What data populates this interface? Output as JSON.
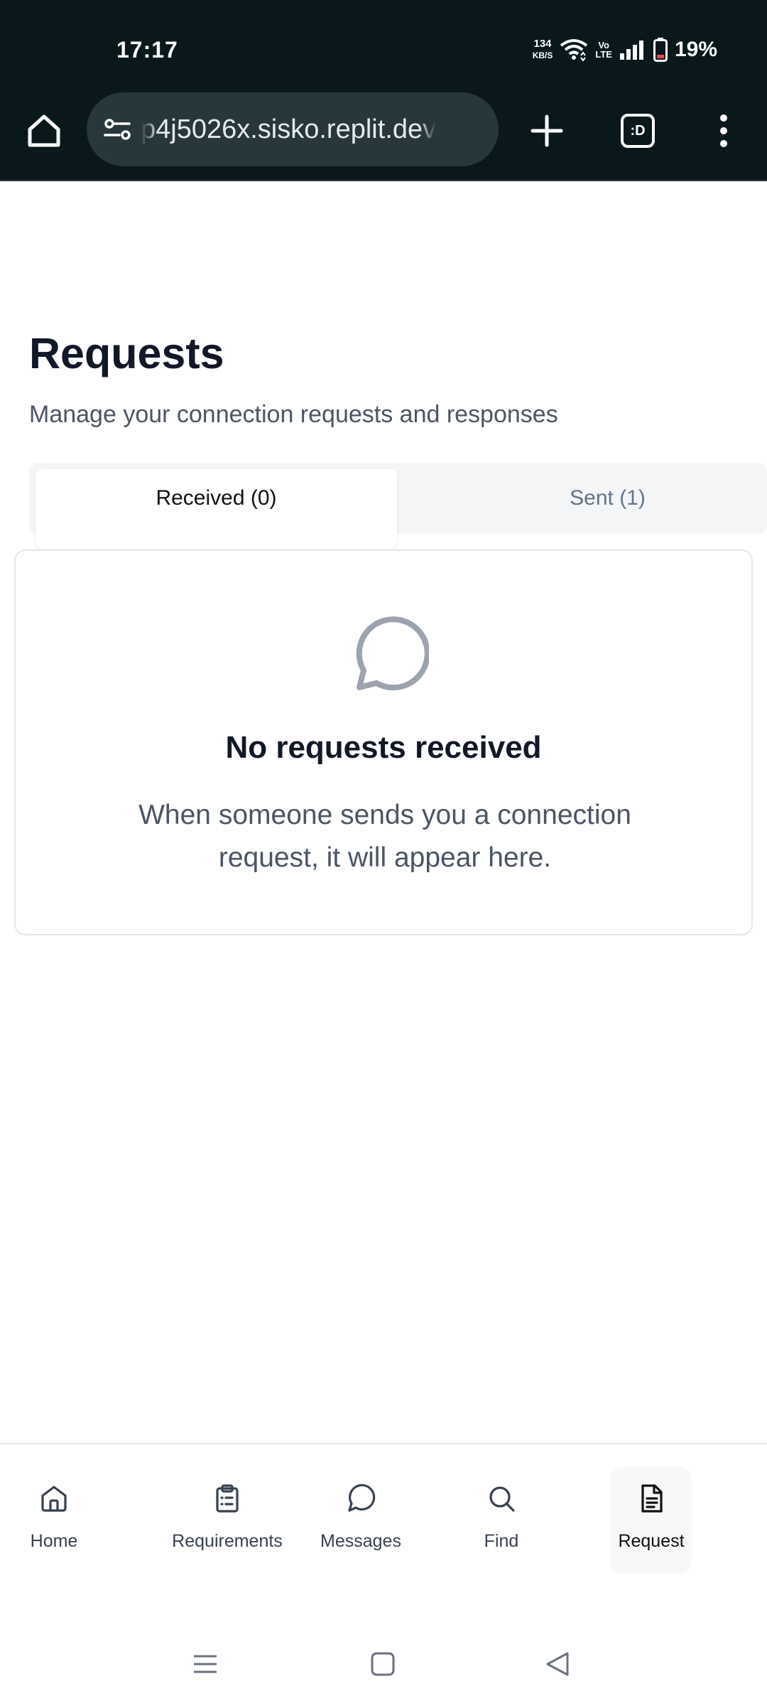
{
  "status_bar": {
    "time": "17:17",
    "net_speed_value": "134",
    "net_speed_unit": "KB/S",
    "volte_top": "Vo",
    "volte_bottom": "LTE",
    "battery_percent": "19%"
  },
  "browser": {
    "url": "p4j5026x.sisko.replit.dev",
    "tab_switcher_label": ":D"
  },
  "page": {
    "title": "Requests",
    "subtitle": "Manage your connection requests and responses"
  },
  "tabs": [
    {
      "label": "Received (0)",
      "active": true
    },
    {
      "label": "Sent (1)",
      "active": false
    }
  ],
  "empty_state": {
    "icon": "message-circle-icon",
    "title": "No requests received",
    "description": "When someone sends you a connection request, it will appear here."
  },
  "bottom_nav": [
    {
      "label": "Home",
      "icon": "home-icon",
      "active": false
    },
    {
      "label": "Requirements",
      "icon": "clipboard-list-icon",
      "active": false
    },
    {
      "label": "Messages",
      "icon": "message-circle-icon",
      "active": false
    },
    {
      "label": "Find",
      "icon": "search-icon",
      "active": false
    },
    {
      "label": "Request",
      "icon": "file-text-icon",
      "active": true
    }
  ],
  "colors": {
    "status_bar_bg": "#0a181c",
    "url_box_bg": "#27373b",
    "text_primary": "#111827",
    "text_secondary": "#4b5563",
    "tabs_bg": "#f3f5f7",
    "inactive_tab": "#64748b",
    "icon_gray": "#9ca3af",
    "battery_low": "#ef4444"
  }
}
